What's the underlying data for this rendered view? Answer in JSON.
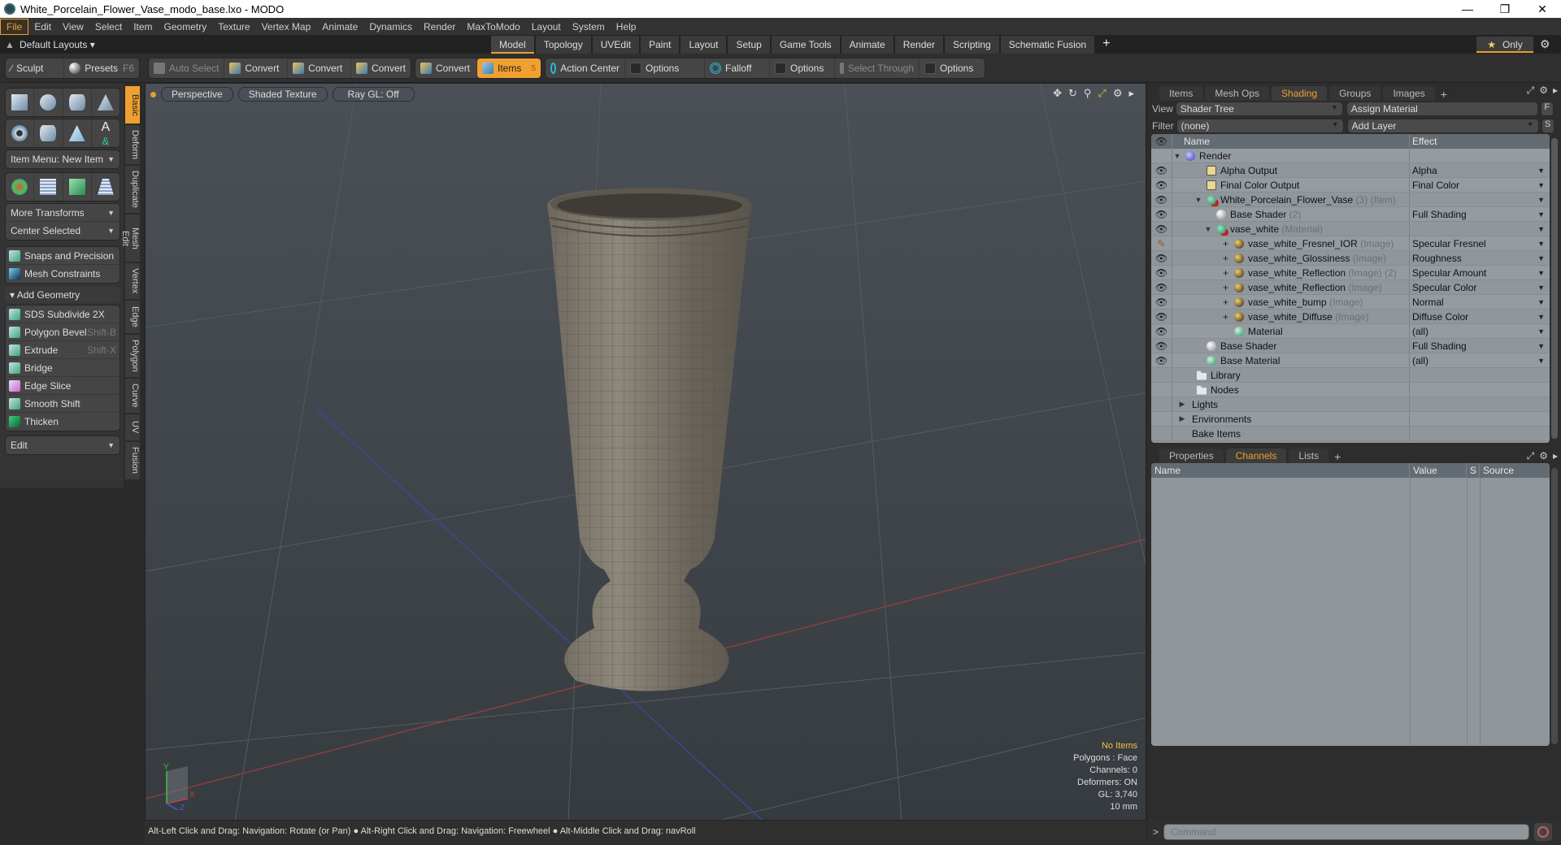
{
  "window": {
    "title": "White_Porcelain_Flower_Vase_modo_base.lxo - MODO",
    "controls": [
      "minimize",
      "restore",
      "close"
    ]
  },
  "menubar": [
    "File",
    "Edit",
    "View",
    "Select",
    "Item",
    "Geometry",
    "Texture",
    "Vertex Map",
    "Animate",
    "Dynamics",
    "Render",
    "MaxToModo",
    "Layout",
    "System",
    "Help"
  ],
  "layoutbar": {
    "layouts_label": "Default Layouts",
    "tabs": [
      "Model",
      "Topology",
      "UVEdit",
      "Paint",
      "Layout",
      "Setup",
      "Game Tools",
      "Animate",
      "Render",
      "Scripting",
      "Schematic Fusion"
    ],
    "active_tab": "Model",
    "only_label": "Only"
  },
  "toolbar": {
    "sculpt": "Sculpt",
    "presets": "Presets",
    "presets_key": "F6",
    "auto_select": "Auto Select",
    "convert1": "Convert",
    "convert2": "Convert",
    "convert3": "Convert",
    "convert4": "Convert",
    "items": "Items",
    "items_count": "5",
    "action_center": "Action Center",
    "options1": "Options",
    "falloff": "Falloff",
    "options2": "Options",
    "select_through": "Select Through",
    "options3": "Options"
  },
  "leftpanel": {
    "item_menu": "Item Menu: New Item",
    "more_transforms": "More Transforms",
    "center_selected": "Center Selected",
    "snaps": "Snaps and Precision",
    "mesh_constraints": "Mesh Constraints",
    "add_geometry": "Add Geometry",
    "tools": [
      {
        "label": "SDS Subdivide 2X",
        "key": ""
      },
      {
        "label": "Polygon Bevel",
        "key": "Shift-B"
      },
      {
        "label": "Extrude",
        "key": "Shift-X"
      },
      {
        "label": "Bridge",
        "key": ""
      },
      {
        "label": "Edge Slice",
        "key": ""
      },
      {
        "label": "Smooth Shift",
        "key": ""
      },
      {
        "label": "Thicken",
        "key": ""
      }
    ],
    "edit_dropdown": "Edit",
    "side_tabs": [
      "Basic",
      "Deform",
      "Duplicate",
      "Mesh Edit",
      "Vertex",
      "Edge",
      "Polygon",
      "Curve",
      "UV",
      "Fusion"
    ],
    "active_side_tab": "Basic"
  },
  "viewport": {
    "view": "Perspective",
    "shading": "Shaded Texture",
    "raygl": "Ray GL: Off",
    "hud": {
      "selection": "No Items",
      "polygons": "Polygons : Face",
      "channels": "Channels: 0",
      "deformers": "Deformers: ON",
      "gl": "GL: 3,740",
      "unit": "10 mm"
    },
    "axis": {
      "x": "X",
      "y": "Y",
      "z": "Z"
    }
  },
  "statusbar": {
    "hint1": "Alt-Left Click and Drag: Navigation: Rotate (or Pan)",
    "hint2": "Alt-Right Click and Drag: Navigation: Freewheel",
    "hint3": "Alt-Middle Click and Drag: navRoll"
  },
  "shading_panel": {
    "tabs": [
      "Items",
      "Mesh Ops",
      "Shading",
      "Groups",
      "Images"
    ],
    "active_tab": "Shading",
    "view_label": "View",
    "view_value": "Shader Tree",
    "assign_material": "Assign Material",
    "f_btn": "F",
    "filter_label": "Filter",
    "filter_value": "(none)",
    "add_layer": "Add Layer",
    "s_btn": "S",
    "col_name": "Name",
    "col_effect": "Effect",
    "rows": [
      {
        "name": "Render",
        "suffix": "",
        "effect": ""
      },
      {
        "name": "Alpha Output",
        "suffix": "",
        "effect": "Alpha"
      },
      {
        "name": "Final Color Output",
        "suffix": "",
        "effect": "Final Color"
      },
      {
        "name": "White_Porcelain_Flower_Vase",
        "suffix": "(3) (Item)",
        "effect": ""
      },
      {
        "name": "Base Shader",
        "suffix": "(2)",
        "effect": "Full Shading"
      },
      {
        "name": "vase_white",
        "suffix": "(Material)",
        "effect": ""
      },
      {
        "name": "vase_white_Fresnel_IOR",
        "suffix": "(Image)",
        "effect": "Specular Fresnel"
      },
      {
        "name": "vase_white_Glossiness",
        "suffix": "(Image)",
        "effect": "Roughness"
      },
      {
        "name": "vase_white_Reflection",
        "suffix": "(Image) (2)",
        "effect": "Specular Amount"
      },
      {
        "name": "vase_white_Reflection",
        "suffix": "(Image)",
        "effect": "Specular Color"
      },
      {
        "name": "vase_white_bump",
        "suffix": "(Image)",
        "effect": "Normal"
      },
      {
        "name": "vase_white_Diffuse",
        "suffix": "(Image)",
        "effect": "Diffuse Color"
      },
      {
        "name": "Material",
        "suffix": "",
        "effect": "(all)"
      },
      {
        "name": "Base Shader",
        "suffix": "",
        "effect": "Full Shading"
      },
      {
        "name": "Base Material",
        "suffix": "",
        "effect": "(all)"
      },
      {
        "name": "Library",
        "suffix": "",
        "effect": ""
      },
      {
        "name": "Nodes",
        "suffix": "",
        "effect": ""
      },
      {
        "name": "Lights",
        "suffix": "",
        "effect": ""
      },
      {
        "name": "Environments",
        "suffix": "",
        "effect": ""
      },
      {
        "name": "Bake Items",
        "suffix": "",
        "effect": ""
      }
    ]
  },
  "channels_panel": {
    "tabs": [
      "Properties",
      "Channels",
      "Lists"
    ],
    "active_tab": "Channels",
    "columns": [
      "Name",
      "Value",
      "S",
      "Source"
    ]
  },
  "command": {
    "placeholder": "Command",
    "prompt": ">"
  },
  "colors": {
    "accent": "#f0a030",
    "hud_highlight": "#f0c040"
  }
}
